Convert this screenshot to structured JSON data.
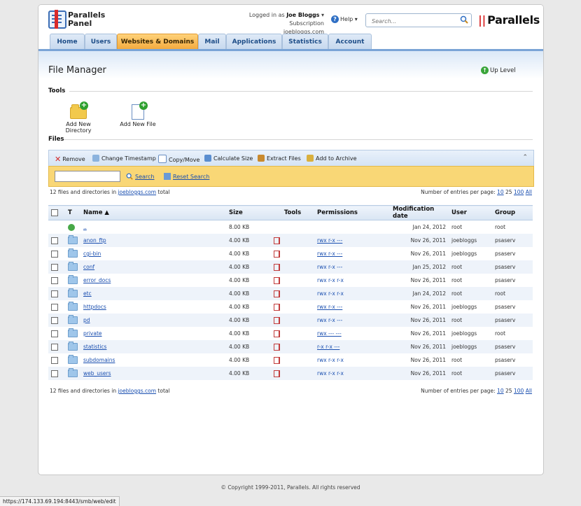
{
  "header": {
    "logo_line1": "Parallels",
    "logo_line2": "Panel",
    "logged_prefix": "Logged in as",
    "user": "Joe Bloggs",
    "subscription_prefix": "Subscription",
    "subscription": "joebloggs.com",
    "help": "Help",
    "search_placeholder": "Search...",
    "brand": "Parallels"
  },
  "tabs": [
    "Home",
    "Users",
    "Websites & Domains",
    "Mail",
    "Applications",
    "Statistics",
    "Account"
  ],
  "active_tab": "Websites & Domains",
  "page": {
    "title": "File Manager",
    "up_level": "Up Level"
  },
  "tools": {
    "heading": "Tools",
    "add_directory": "Add New Directory",
    "add_file": "Add New File"
  },
  "files_heading": "Files",
  "actions": [
    "Remove",
    "Change Timestamp",
    "Copy/Move",
    "Calculate Size",
    "Extract Files",
    "Add to Archive"
  ],
  "search_bar": {
    "search": "Search",
    "reset": "Reset Search",
    "value": ""
  },
  "summary": {
    "prefix": "12 files and directories in",
    "domain": "joebloggs.com",
    "suffix": "total",
    "per_page_label": "Number of entries per page:",
    "per_page": [
      "10",
      "25",
      "100",
      "All"
    ]
  },
  "columns": [
    "T",
    "Name ▲",
    "Size",
    "Tools",
    "Permissions",
    "Modification date",
    "User",
    "Group"
  ],
  "rows": [
    {
      "name": "..",
      "size": "8.00 KB",
      "perm": "",
      "date": "Jan 24, 2012",
      "user": "root",
      "group": "root",
      "up": true
    },
    {
      "name": "anon_ftp",
      "size": "4.00 KB",
      "perm": "rwx r-x ---",
      "date": "Nov 26, 2011",
      "user": "joebloggs",
      "group": "psaserv",
      "perm_link": true
    },
    {
      "name": "cgi-bin",
      "size": "4.00 KB",
      "perm": "rwx r-x ---",
      "date": "Nov 26, 2011",
      "user": "joebloggs",
      "group": "psaserv",
      "perm_link": true
    },
    {
      "name": "conf",
      "size": "4.00 KB",
      "perm": "rwx r-x ---",
      "date": "Jan 25, 2012",
      "user": "root",
      "group": "psaserv",
      "perm_link": false
    },
    {
      "name": "error_docs",
      "size": "4.00 KB",
      "perm": "rwx r-x r-x",
      "date": "Nov 26, 2011",
      "user": "root",
      "group": "psaserv",
      "perm_link": false
    },
    {
      "name": "etc",
      "size": "4.00 KB",
      "perm": "rwx r-x r-x",
      "date": "Jan 24, 2012",
      "user": "root",
      "group": "root",
      "perm_link": false
    },
    {
      "name": "httpdocs",
      "size": "4.00 KB",
      "perm": "rwx r-x ---",
      "date": "Nov 26, 2011",
      "user": "joebloggs",
      "group": "psaserv",
      "perm_link": true
    },
    {
      "name": "pd",
      "size": "4.00 KB",
      "perm": "rwx r-x ---",
      "date": "Nov 26, 2011",
      "user": "root",
      "group": "psaserv",
      "perm_link": false
    },
    {
      "name": "private",
      "size": "4.00 KB",
      "perm": "rwx --- ---",
      "date": "Nov 26, 2011",
      "user": "joebloggs",
      "group": "root",
      "perm_link": true
    },
    {
      "name": "statistics",
      "size": "4.00 KB",
      "perm": "r-x r-x ---",
      "date": "Nov 26, 2011",
      "user": "joebloggs",
      "group": "psaserv",
      "perm_link": true
    },
    {
      "name": "subdomains",
      "size": "4.00 KB",
      "perm": "rwx r-x r-x",
      "date": "Nov 26, 2011",
      "user": "root",
      "group": "psaserv",
      "perm_link": false
    },
    {
      "name": "web_users",
      "size": "4.00 KB",
      "perm": "rwx r-x r-x",
      "date": "Nov 26, 2011",
      "user": "root",
      "group": "psaserv",
      "perm_link": false
    }
  ],
  "footer": "© Copyright 1999-2011, Parallels. All rights reserved",
  "status_url": "https://174.133.69.194:8443/smb/web/edit",
  "colors": {
    "accent_tab": "#f3a93c",
    "tab_blue": "#c6d8ee",
    "search_bar": "#f9d776"
  }
}
